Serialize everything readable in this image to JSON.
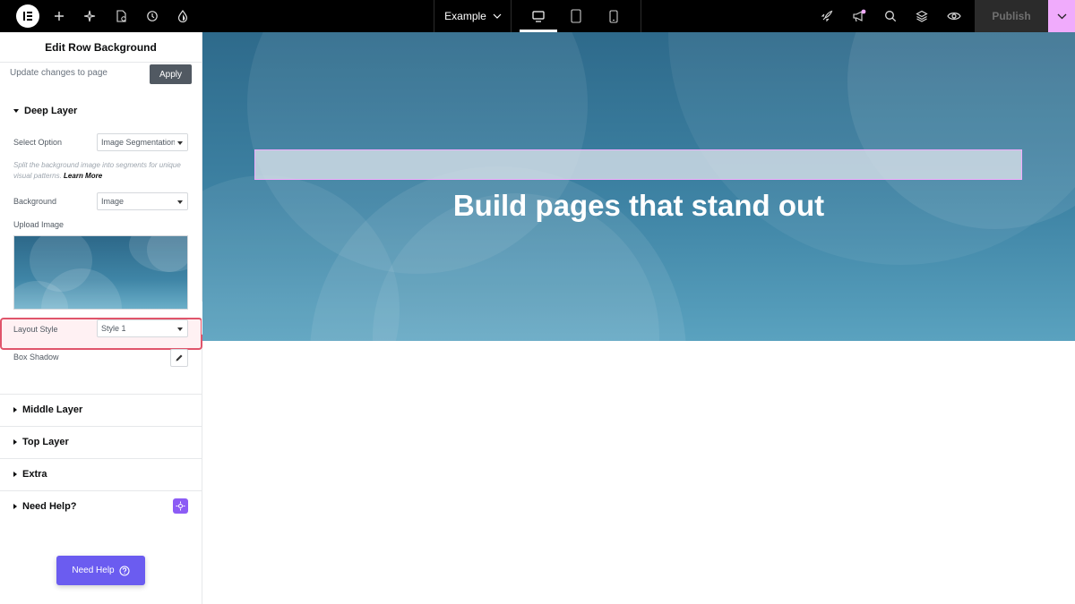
{
  "topbar": {
    "page_name": "Example",
    "publish_label": "Publish",
    "icons": [
      "elementor-logo-icon",
      "add-icon",
      "ai-sparkle-icon",
      "page-settings-icon",
      "history-icon",
      "site-settings-icon",
      "desktop-icon",
      "tablet-icon",
      "mobile-icon",
      "launch-icon",
      "announcements-icon",
      "search-icon",
      "structure-icon",
      "preview-icon",
      "chevron-down-icon"
    ]
  },
  "panel": {
    "title": "Edit Row Background",
    "update_text": "Update changes to page",
    "apply_label": "Apply",
    "deep_layer": {
      "heading": "Deep Layer",
      "select_option_label": "Select Option",
      "select_option_value": "Image Segmentation",
      "help_text": "Split the background image into segments for unique visual patterns.",
      "learn_more": "Learn More",
      "background_label": "Background",
      "background_value": "Image",
      "upload_label": "Upload Image",
      "layout_style_label": "Layout Style",
      "layout_style_value": "Style 1",
      "box_shadow_label": "Box Shadow"
    },
    "sections": [
      "Middle Layer",
      "Top Layer",
      "Extra",
      "Need Help?"
    ],
    "need_help_button": "Need Help"
  },
  "canvas": {
    "hero_title": "Build pages that stand out"
  },
  "colors": {
    "topbar": "#000000",
    "accent_pink": "#f0abfc",
    "need_help": "#6b5cf0",
    "highlight": "#e0556b"
  }
}
